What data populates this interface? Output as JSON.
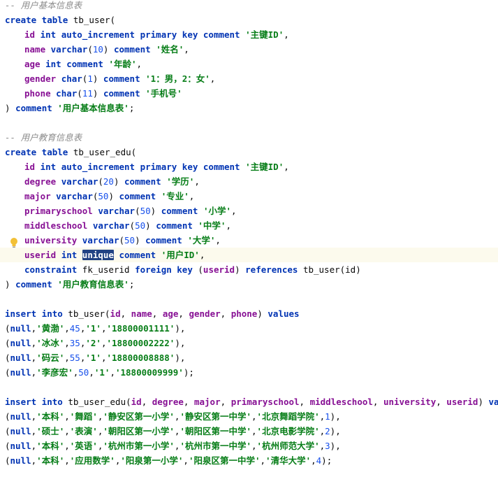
{
  "block1": {
    "comment": "-- 用户基本信息表",
    "create_kw": "create table",
    "table": "tb_user(",
    "rows": [
      {
        "col": "id",
        "type": "int",
        "mods": "auto_increment primary key",
        "ckw": "comment",
        "str": "'主键ID'",
        "end": ","
      },
      {
        "col": "name",
        "type": "varchar",
        "len": "10",
        "ckw": "comment",
        "str": "'姓名'",
        "end": ","
      },
      {
        "col": "age",
        "type": "int",
        "ckw": "comment",
        "str": "'年龄'",
        "end": ","
      },
      {
        "col": "gender",
        "type": "char",
        "len": "1",
        "ckw": "comment",
        "str": "'1：男，2：女'",
        "end": ","
      },
      {
        "col": "phone",
        "type": "char",
        "len": "11",
        "ckw": "comment",
        "str": "'手机号'",
        "end": ""
      }
    ],
    "close": ")",
    "close_comment_kw": "comment",
    "close_comment": "'用户基本信息表'",
    "close_end": ";"
  },
  "block2": {
    "comment": "-- 用户教育信息表",
    "create_kw": "create table",
    "table": "tb_user_edu(",
    "rows": [
      {
        "col": "id",
        "type": "int",
        "mods": "auto_increment primary key",
        "ckw": "comment",
        "str": "'主键ID'",
        "end": ","
      },
      {
        "col": "degree",
        "type": "varchar",
        "len": "20",
        "ckw": "comment",
        "str": "'学历'",
        "end": ","
      },
      {
        "col": "major",
        "type": "varchar",
        "len": "50",
        "ckw": "comment",
        "str": "'专业'",
        "end": ","
      },
      {
        "col": "primaryschool",
        "type": "varchar",
        "len": "50",
        "ckw": "comment",
        "str": "'小学'",
        "end": ","
      },
      {
        "col": "middleschool",
        "type": "varchar",
        "len": "50",
        "ckw": "comment",
        "str": "'中学'",
        "end": ","
      },
      {
        "col": "university",
        "type": "varchar",
        "len": "50",
        "ckw": "comment",
        "str": "'大学'",
        "end": ","
      },
      {
        "col": "userid",
        "type": "int",
        "selected": "unique",
        "ckw": "comment",
        "str": "'用户ID'",
        "end": ","
      }
    ],
    "constraint": {
      "kw1": "constraint",
      "name": "fk_userid",
      "kw2": "foreign key",
      "col": "(userid)",
      "kw3": "references",
      "ref": "tb_user(id)"
    },
    "close": ")",
    "close_comment_kw": "comment",
    "close_comment": "'用户教育信息表'",
    "close_end": ";"
  },
  "insert1": {
    "kw1": "insert into",
    "table": "tb_user(",
    "cols": [
      "id",
      "name",
      "age",
      "gender",
      "phone"
    ],
    "kw2": "values",
    "rows": [
      {
        "n": "null",
        "s1": "'黄渤'",
        "num": "45",
        "s2": "'1'",
        "s3": "'18800001111'",
        "end": "),"
      },
      {
        "n": "null",
        "s1": "'冰冰'",
        "num": "35",
        "s2": "'2'",
        "s3": "'18800002222'",
        "end": "),"
      },
      {
        "n": "null",
        "s1": "'码云'",
        "num": "55",
        "s2": "'1'",
        "s3": "'18800008888'",
        "end": "),"
      },
      {
        "n": "null",
        "s1": "'李彦宏'",
        "num": "50",
        "s2": "'1'",
        "s3": "'18800009999'",
        "end": ");"
      }
    ]
  },
  "insert2": {
    "kw1": "insert into",
    "table": "tb_user_edu(",
    "cols": [
      "id",
      "degree",
      "major",
      "primaryschool",
      "middleschool",
      "university",
      "userid"
    ],
    "kw2": "values",
    "rows": [
      {
        "n": "null",
        "vals": [
          "'本科'",
          "'舞蹈'",
          "'静安区第一小学'",
          "'静安区第一中学'",
          "'北京舞蹈学院'"
        ],
        "num": "1",
        "end": "),"
      },
      {
        "n": "null",
        "vals": [
          "'硕士'",
          "'表演'",
          "'朝阳区第一小学'",
          "'朝阳区第一中学'",
          "'北京电影学院'"
        ],
        "num": "2",
        "end": "),"
      },
      {
        "n": "null",
        "vals": [
          "'本科'",
          "'英语'",
          "'杭州市第一小学'",
          "'杭州市第一中学'",
          "'杭州师范大学'"
        ],
        "num": "3",
        "end": "),"
      },
      {
        "n": "null",
        "vals": [
          "'本科'",
          "'应用数学'",
          "'阳泉第一小学'",
          "'阳泉区第一中学'",
          "'清华大学'"
        ],
        "num": "4",
        "end": ");"
      }
    ]
  },
  "icons": {
    "intention": "lightbulb-icon",
    "bulb_color": "#f2c037"
  }
}
